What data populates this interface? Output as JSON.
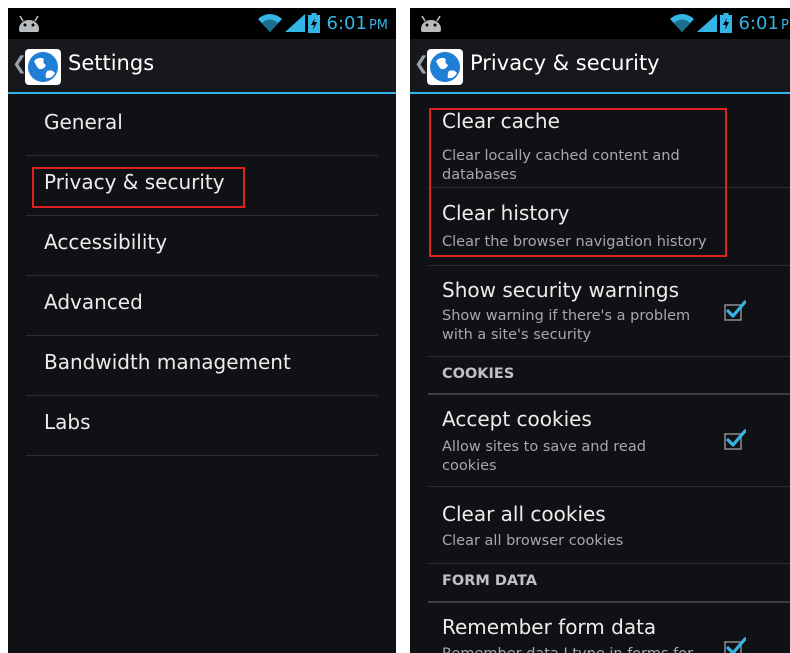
{
  "status": {
    "time": "6:01",
    "ampm": "PM"
  },
  "left": {
    "title": "Settings",
    "items": [
      {
        "label": "General"
      },
      {
        "label": "Privacy & security"
      },
      {
        "label": "Accessibility"
      },
      {
        "label": "Advanced"
      },
      {
        "label": "Bandwidth management"
      },
      {
        "label": "Labs"
      }
    ]
  },
  "right": {
    "title": "Privacy & security",
    "clear_cache": {
      "title": "Clear cache",
      "summary": "Clear locally cached content and databases"
    },
    "clear_history": {
      "title": "Clear history",
      "summary": "Clear the browser navigation history"
    },
    "security_warnings": {
      "title": "Show security warnings",
      "summary": "Show warning if there's a problem with a site's security",
      "checked": true
    },
    "cookies_header": "COOKIES",
    "accept_cookies": {
      "title": "Accept cookies",
      "summary": "Allow sites to save and read cookies",
      "checked": true
    },
    "clear_cookies": {
      "title": "Clear all cookies",
      "summary": "Clear all browser cookies"
    },
    "form_data_header": "FORM DATA",
    "remember_form": {
      "title": "Remember form data",
      "summary": "Remember data I type in forms for",
      "checked": true
    }
  },
  "colors": {
    "accent": "#33b5e5",
    "highlight": "#e02020",
    "background": "#101114"
  }
}
